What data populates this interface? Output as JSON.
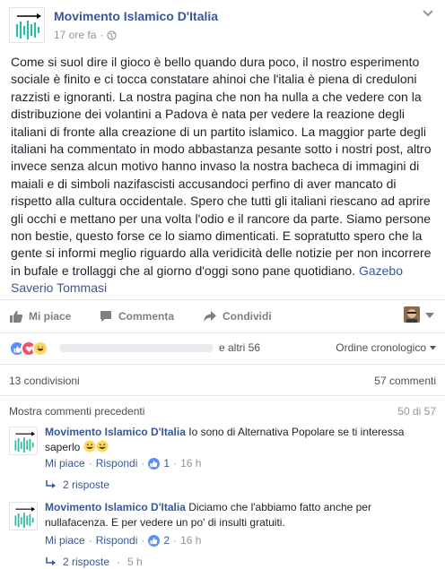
{
  "post": {
    "page_name": "Movimento Islamico D'Italia",
    "time": "17 ore fa",
    "separator": "·",
    "text_1": "Come si suol dire il gioco è bello quando dura poco, il nostro esperimento sociale è finito e ci tocca constatare ahinoi che l'italia è piena di creduloni razzisti e ignoranti. La nostra pagina che non ha nulla a che vedere con la distribuzione dei volantini a Padova è nata per vedere la reazione degli italiani di fronte alla creazione di un partito islamico. La maggior parte degli italiani ha commentato in modo abbastanza pesante sotto i nostri post, altro invece senza alcun motivo hanno invaso la nostra bacheca di immagini di maiali e di simboli nazifascisti accusandoci perfino di aver mancato di rispetto alla cultura occidentale. Spero che tutti gli italiani riescano ad aprire gli occhi e mettano per una volta l'odio e il rancore da parte. Siamo persone non bestie, questo forse ce lo siamo dimenticati. E sopratutto spero che la gente si informi meglio riguardo alla veridicità delle notizie per non incorrere in bufale e trollaggi che al giorno d'oggi sono pane quotidiano.",
    "author_link": "Gazebo Saverio Tommasi"
  },
  "actions": {
    "like": "Mi piace",
    "comment": "Commenta",
    "share": "Condividi"
  },
  "reactions": {
    "icons": [
      "like-icon",
      "love-icon",
      "haha-icon"
    ],
    "others": "e altri 56",
    "order": "Ordine cronologico"
  },
  "counts": {
    "shares": "13 condivisioni",
    "comments": "57 commenti"
  },
  "previous": {
    "label": "Mostra commenti precedenti",
    "pager": "50 di 57"
  },
  "comments": [
    {
      "author": "Movimento Islamico D'Italia",
      "text": "Io sono di Alternativa Popolare se ti interessa saperlo",
      "like": "Mi piace",
      "reply": "Rispondi",
      "likes": "1",
      "time": "16 h",
      "replies": "2 risposte",
      "reply_time": ""
    },
    {
      "author": "Movimento Islamico D'Italia",
      "text": "Diciamo che l'abbiamo fatto anche per nullafacenza. E per vedere un po' di insulti gratuiti.",
      "like": "Mi piace",
      "reply": "Rispondi",
      "likes": "2",
      "time": "16 h",
      "replies": "2 risposte",
      "reply_time": "5 h"
    }
  ],
  "colors": {
    "link": "#365899",
    "text": "#1d2129",
    "muted": "#90949c",
    "like_blue": "#5890ff",
    "love_red": "#f25268",
    "haha_yellow": "#fdd761"
  }
}
